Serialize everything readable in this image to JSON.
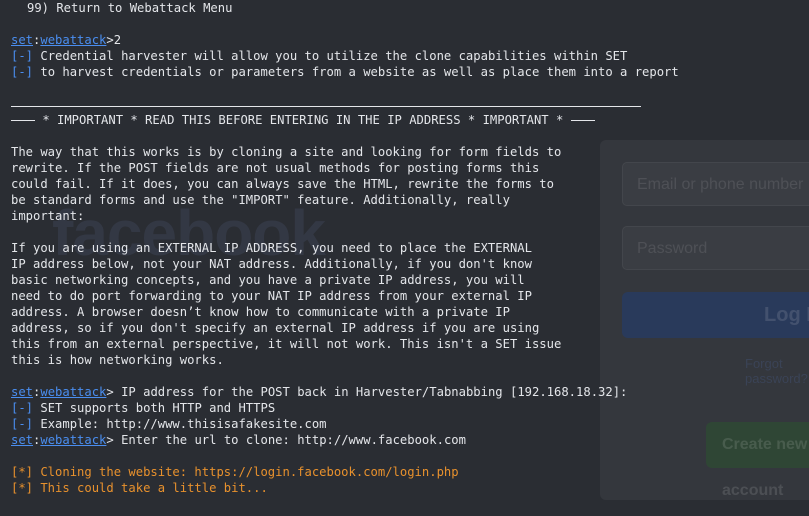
{
  "background_overlay": {
    "logo_text": "facebook",
    "email_placeholder": "Email or phone number",
    "password_placeholder": "Password",
    "login_button": "Log In",
    "forgot_link": "Forgot password?",
    "create_button": "Create new account"
  },
  "terminal": {
    "menu_item": "99) Return to Webattack Menu",
    "prompt1": {
      "set": "set",
      "module": "webattack",
      "input": "2"
    },
    "info1": "Credential harvester will allow you to utilize the clone capabilities within SET",
    "info2": "to harvest credentials or parameters from a website as well as place them into a report",
    "important_header": " * IMPORTANT * READ THIS BEFORE ENTERING IN THE IP ADDRESS * IMPORTANT * ",
    "para1": [
      "The way that this works is by cloning a site and looking for form fields to",
      "rewrite. If the POST fields are not usual methods for posting forms this",
      "could fail. If it does, you can always save the HTML, rewrite the forms to",
      "be standard forms and use the \"IMPORT\" feature. Additionally, really",
      "important:"
    ],
    "para2": [
      "If you are using an EXTERNAL IP ADDRESS, you need to place the EXTERNAL",
      "IP address below, not your NAT address. Additionally, if you don't know",
      "basic networking concepts, and you have a private IP address, you will",
      "need to do port forwarding to your NAT IP address from your external IP",
      "address. A browser doesn’t know how to communicate with a private IP",
      "address, so if you don't specify an external IP address if you are using",
      "this from an external perspective, it will not work. This isn't a SET issue",
      "this is how networking works."
    ],
    "prompt2": {
      "set": "set",
      "module": "webattack",
      "text": "IP address for the POST back in Harvester/Tabnabbing [192.168.18.32]:"
    },
    "info3": "SET supports both HTTP and HTTPS",
    "info4": "Example: http://www.thisisafakesite.com",
    "prompt3": {
      "set": "set",
      "module": "webattack",
      "text": "Enter the url to clone: http://www.facebook.com"
    },
    "status1": "[*] Cloning the website: https://login.facebook.com/login.php",
    "status2": "[*] This could take a little bit...",
    "bullet": "[-]"
  },
  "colors": {
    "background": "#2a2d33",
    "text": "#e4e6ea",
    "accent_blue": "#4a8ef0",
    "status_orange": "#e8912d"
  }
}
